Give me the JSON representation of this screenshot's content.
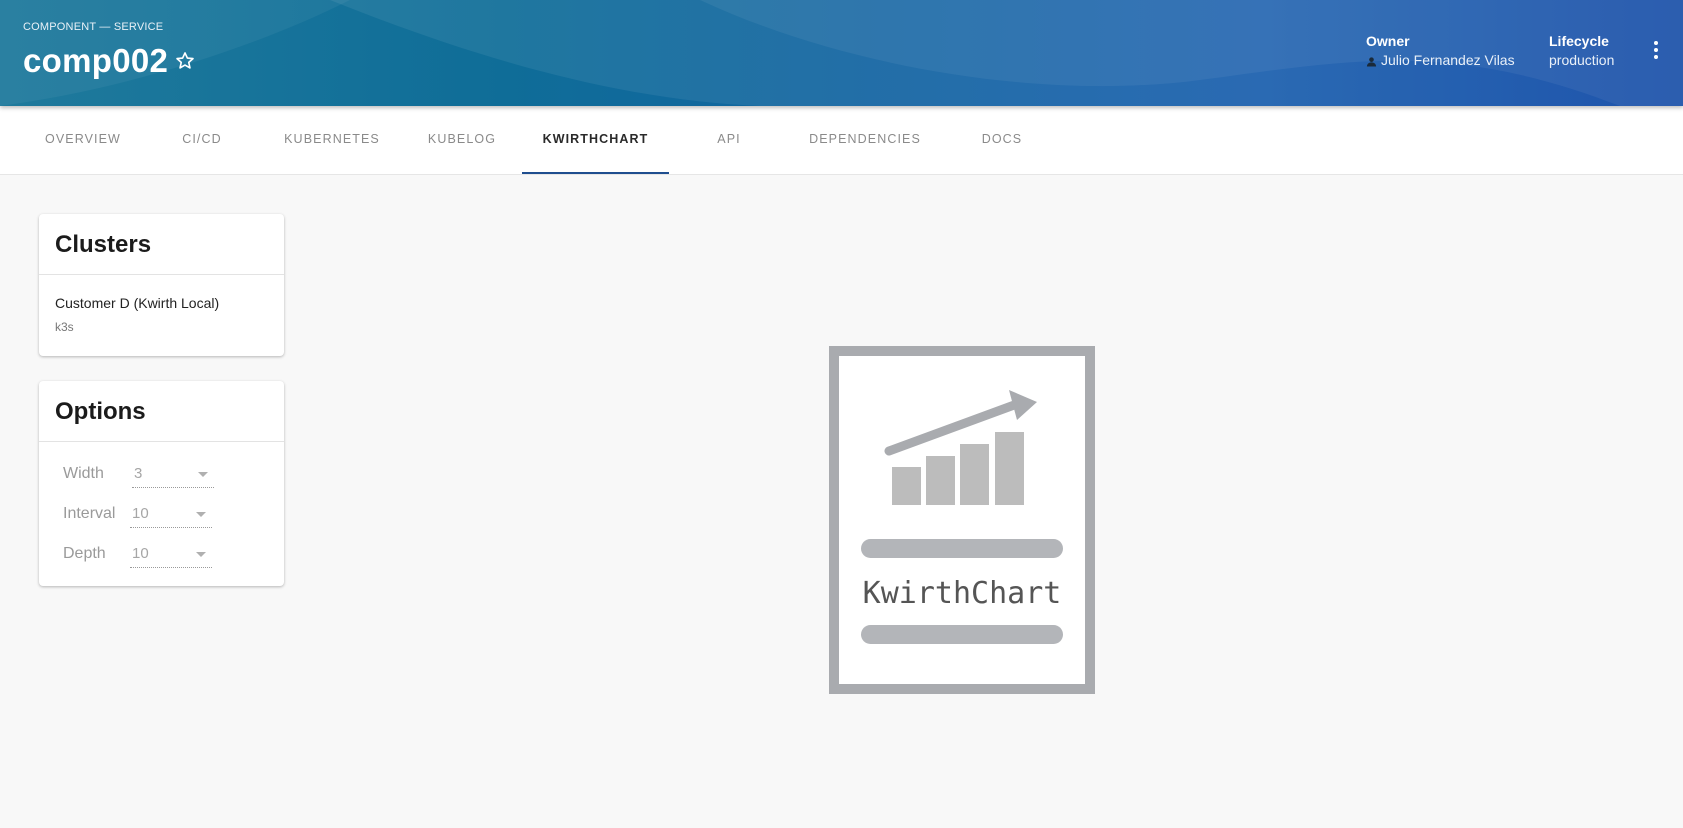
{
  "header": {
    "kind": "COMPONENT — SERVICE",
    "title": "comp002",
    "owner_label": "Owner",
    "owner_value": "Julio Fernandez Vilas",
    "lifecycle_label": "Lifecycle",
    "lifecycle_value": "production",
    "favorite_icon": "star-outline-icon",
    "menu_icon": "more-vertical-icon"
  },
  "tabs": [
    {
      "label": "OVERVIEW",
      "active": false
    },
    {
      "label": "CI/CD",
      "active": false
    },
    {
      "label": "KUBERNETES",
      "active": false
    },
    {
      "label": "KUBELOG",
      "active": false
    },
    {
      "label": "KWIRTHCHART",
      "active": true
    },
    {
      "label": "API",
      "active": false
    },
    {
      "label": "DEPENDENCIES",
      "active": false
    },
    {
      "label": "DOCS",
      "active": false
    }
  ],
  "clusters": {
    "title": "Clusters",
    "items": [
      {
        "name": "Customer D (Kwirth Local)",
        "type": "k3s"
      }
    ]
  },
  "options": {
    "title": "Options",
    "fields": [
      {
        "label": "Width",
        "value": "3"
      },
      {
        "label": "Interval",
        "value": "10"
      },
      {
        "label": "Depth",
        "value": "10"
      }
    ]
  },
  "logo": {
    "text": "KwirthChart"
  },
  "colors": {
    "accent": "#1f4e8f",
    "header_start": "#1f7a9c",
    "header_end": "#0e47a5",
    "logo_gray": "#a9abaf"
  }
}
